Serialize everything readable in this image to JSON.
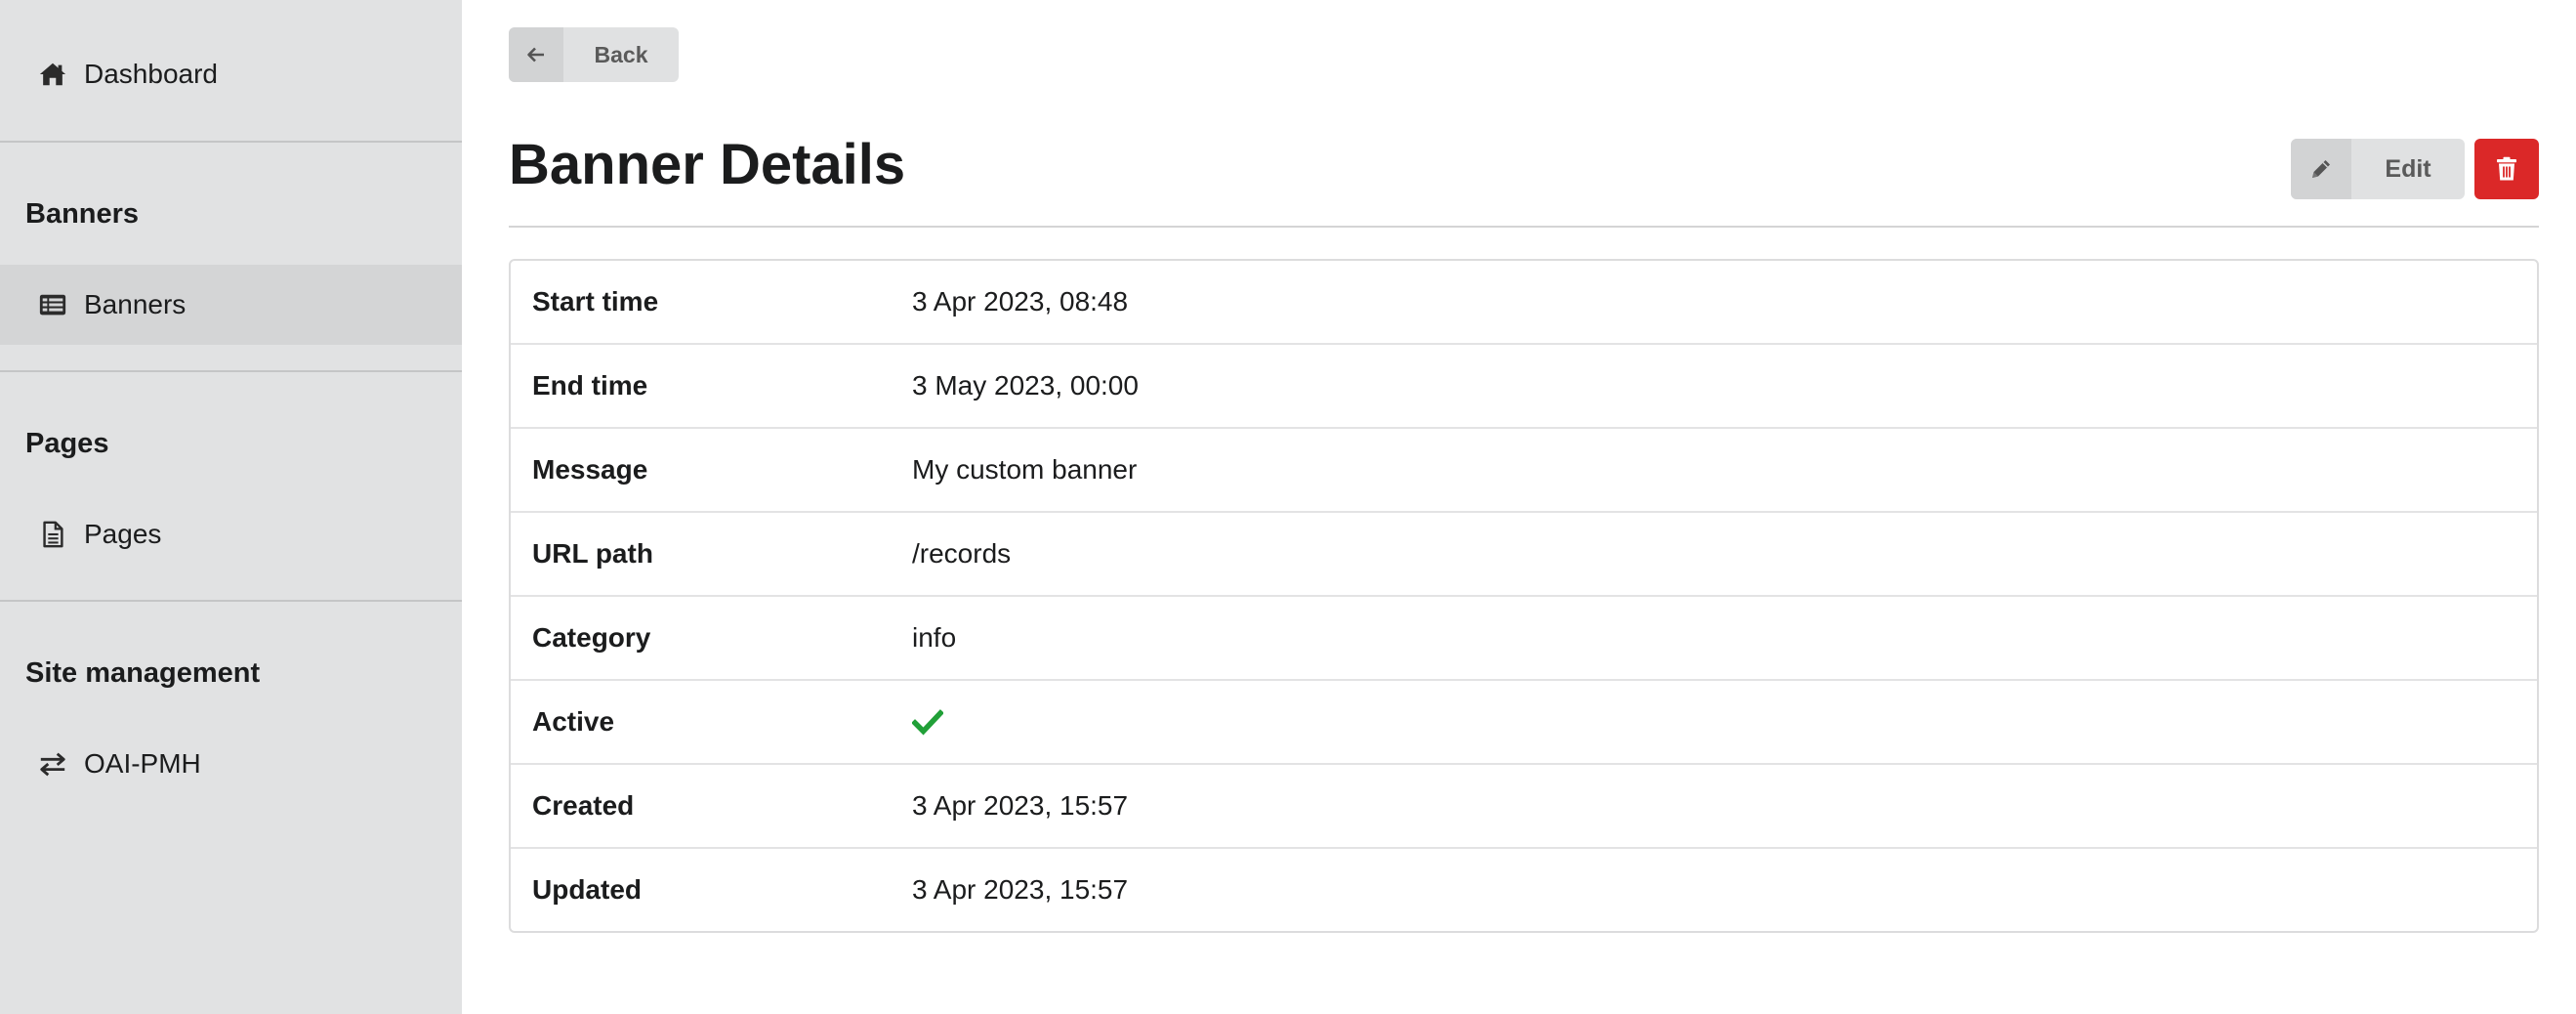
{
  "sidebar": {
    "dashboard": {
      "label": "Dashboard",
      "icon": "home-icon"
    },
    "sections": [
      {
        "header": "Banners",
        "items": [
          {
            "label": "Banners",
            "icon": "table-list-icon",
            "active": true
          }
        ]
      },
      {
        "header": "Pages",
        "items": [
          {
            "label": "Pages",
            "icon": "file-icon",
            "active": false
          }
        ]
      },
      {
        "header": "Site management",
        "items": [
          {
            "label": "OAI-PMH",
            "icon": "exchange-icon",
            "active": false
          }
        ]
      }
    ]
  },
  "main": {
    "back_label": "Back",
    "title": "Banner Details",
    "edit_label": "Edit",
    "details": [
      {
        "key": "Start time",
        "value": "3 Apr 2023, 08:48"
      },
      {
        "key": "End time",
        "value": "3 May 2023, 00:00"
      },
      {
        "key": "Message",
        "value": "My custom banner"
      },
      {
        "key": "URL path",
        "value": "/records"
      },
      {
        "key": "Category",
        "value": "info"
      },
      {
        "key": "Active",
        "value": true
      },
      {
        "key": "Created",
        "value": "3 Apr 2023, 15:57"
      },
      {
        "key": "Updated",
        "value": "3 Apr 2023, 15:57"
      }
    ]
  },
  "colors": {
    "sidebar_bg": "#e1e2e3",
    "sidebar_active_bg": "#d4d5d6",
    "button_bg": "#e0e1e2",
    "danger": "#db2828",
    "success": "#21a038"
  }
}
